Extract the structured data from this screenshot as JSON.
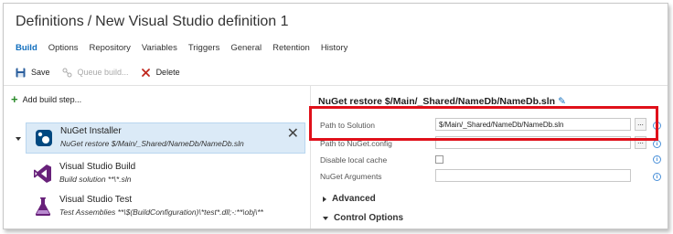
{
  "header": {
    "breadcrumb_root": "Definitions",
    "separator": "/",
    "definition_name": "New Visual Studio definition 1"
  },
  "tabs": [
    {
      "label": "Build",
      "active": true
    },
    {
      "label": "Options"
    },
    {
      "label": "Repository"
    },
    {
      "label": "Variables"
    },
    {
      "label": "Triggers"
    },
    {
      "label": "General"
    },
    {
      "label": "Retention"
    },
    {
      "label": "History"
    }
  ],
  "toolbar": {
    "save_label": "Save",
    "queue_label": "Queue build...",
    "delete_label": "Delete"
  },
  "steps_panel": {
    "add_label": "Add build step...",
    "steps": [
      {
        "name": "NuGet Installer",
        "description": "NuGet restore $/Main/_Shared/NameDb/NameDb.sln",
        "icon": "nuget-icon",
        "selected": true
      },
      {
        "name": "Visual Studio Build",
        "description": "Build solution **\\*.sln",
        "icon": "visual-studio-icon"
      },
      {
        "name": "Visual Studio Test",
        "description": "Test Assemblies **\\$(BuildConfiguration)\\*test*.dll;-:**\\obj\\**",
        "icon": "flask-icon"
      }
    ]
  },
  "detail": {
    "title": "NuGet restore $/Main/_Shared/NameDb/NameDb.sln",
    "fields": {
      "path_label": "Path to Solution",
      "path_value": "$/Main/_Shared/NameDb/NameDb.sln",
      "config_label": "Path to NuGet.config",
      "config_value": "",
      "cache_label": "Disable local cache",
      "args_label": "NuGet Arguments",
      "args_value": ""
    },
    "browse_label": "...",
    "info_label": "i",
    "sections": {
      "advanced": "Advanced",
      "control": "Control Options"
    }
  },
  "colors": {
    "accent": "#106ebe",
    "highlight": "#e0101a",
    "selected_bg": "#dbeaf7",
    "add_green": "#2a8a2a"
  }
}
